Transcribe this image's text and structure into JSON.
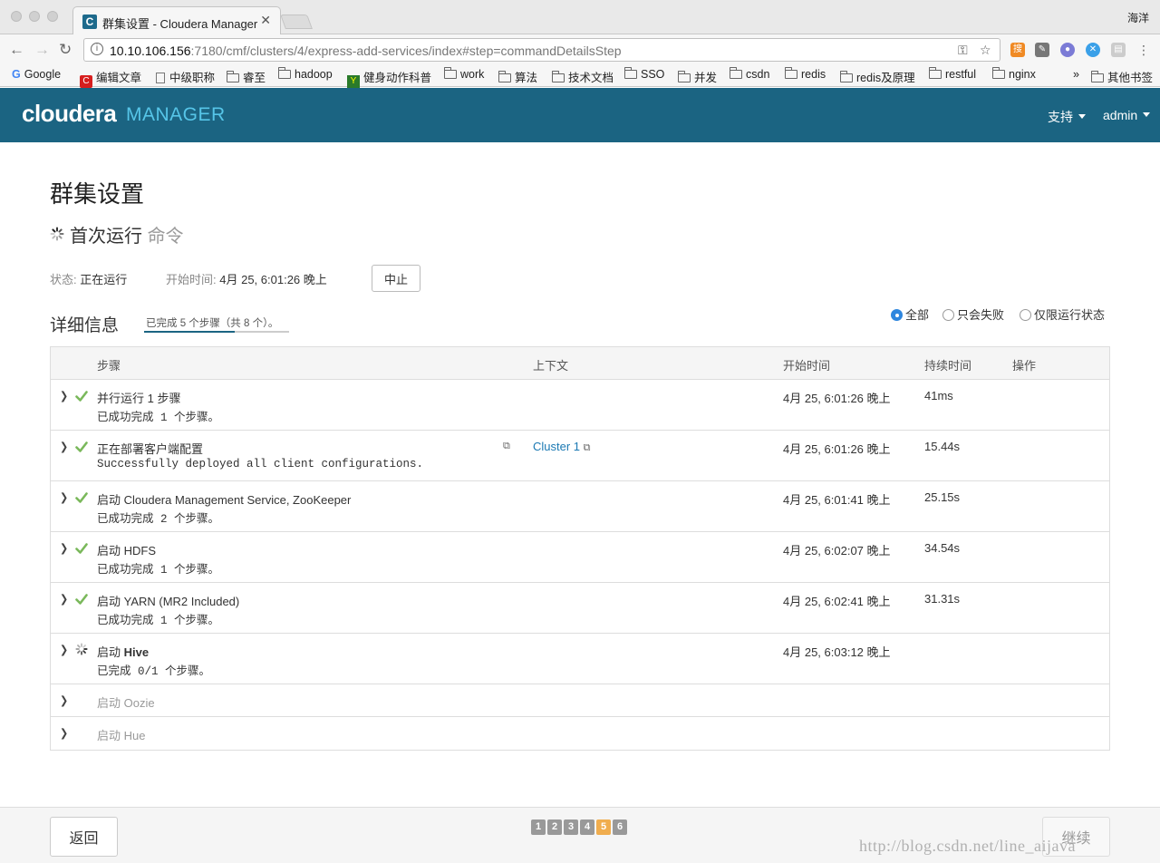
{
  "browser": {
    "tab_title": "群集设置 - Cloudera Manager",
    "tab_favicon": "C",
    "user": "海洋",
    "url_host": "10.10.106.156",
    "url_path": ":7180/cmf/clusters/4/express-add-services/index#step=commandDetailsStep",
    "bookmarks": [
      "Google",
      "编辑文章",
      "中级职称",
      "睿至",
      "hadoop",
      "健身动作科普",
      "work",
      "算法",
      "技术文档",
      "SSO",
      "并发",
      "csdn",
      "redis",
      "redis及原理",
      "restful",
      "nginx"
    ],
    "bookmarks_more": "»",
    "other_bookmarks": "其他书签"
  },
  "header": {
    "logo": "cloudera",
    "logo_suffix": "MANAGER",
    "support": "支持",
    "user": "admin"
  },
  "page": {
    "title": "群集设置",
    "command_title": "首次运行",
    "command_suffix": "命令",
    "status_label": "状态:",
    "status_value": "正在运行",
    "start_label": "开始时间:",
    "start_value": "4月 25, 6:01:26 晚上",
    "abort_button": "中止",
    "details_title": "详细信息",
    "progress_text": "已完成 5 个步骤（共 8 个）。",
    "progress_fraction": 0.625,
    "filters": [
      {
        "label": "全部",
        "selected": true
      },
      {
        "label": "只会失败",
        "selected": false
      },
      {
        "label": "仅限运行状态",
        "selected": false
      }
    ]
  },
  "table": {
    "headers": {
      "step": "步骤",
      "context": "上下文",
      "start": "开始时间",
      "duration": "持续时间",
      "actions": "操作"
    },
    "rows": [
      {
        "name": "并行运行 1 步骤",
        "sub": "已成功完成 1 个步骤。",
        "context": "",
        "start": "4月 25, 6:01:26 晚上",
        "duration": "41ms",
        "state": "done"
      },
      {
        "name": "正在部署客户端配置",
        "sub": "Successfully deployed all client configurations.",
        "context": "Cluster 1",
        "start": "4月 25, 6:01:26 晚上",
        "duration": "15.44s",
        "state": "done"
      },
      {
        "name": "启动 Cloudera Management Service, ZooKeeper",
        "sub": "已成功完成 2 个步骤。",
        "context": "",
        "start": "4月 25, 6:01:41 晚上",
        "duration": "25.15s",
        "state": "done"
      },
      {
        "name": "启动 HDFS",
        "sub": "已成功完成 1 个步骤。",
        "context": "",
        "start": "4月 25, 6:02:07 晚上",
        "duration": "34.54s",
        "state": "done"
      },
      {
        "name": "启动 YARN (MR2 Included)",
        "sub": "已成功完成 1 个步骤。",
        "context": "",
        "start": "4月 25, 6:02:41 晚上",
        "duration": "31.31s",
        "state": "done"
      },
      {
        "name_prefix": "启动",
        "name_bold": "Hive",
        "sub": "已完成 0/1 个步骤。",
        "context": "",
        "start": "4月 25, 6:03:12 晚上",
        "duration": "",
        "state": "running"
      },
      {
        "name": "启动 Oozie",
        "state": "pending"
      },
      {
        "name": "启动 Hue",
        "state": "pending"
      }
    ]
  },
  "footer": {
    "back": "返回",
    "next": "继续",
    "pages": [
      "1",
      "2",
      "3",
      "4",
      "5",
      "6"
    ],
    "active_page": "5",
    "watermark": "http://blog.csdn.net/line_aijava"
  },
  "colors": {
    "header_bg": "#1b6482",
    "logo_accent": "#56c5e8",
    "check_green": "#7ab85b",
    "link_blue": "#1b79b3",
    "active_page": "#f0ad4e"
  }
}
